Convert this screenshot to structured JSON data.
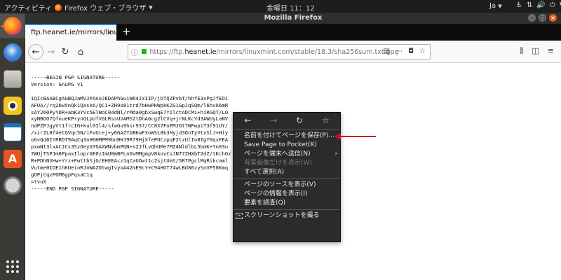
{
  "top_panel": {
    "activities": "アクティビティ",
    "app_name": "Firefox ウェブ・ブラウザ",
    "clock": "金曜日 11：12",
    "lang": "Ja"
  },
  "window": {
    "title": "Mozilla Firefox"
  },
  "tabs": [
    {
      "label": "ftp.heanet.ie/mirrors/linux"
    }
  ],
  "urlbar": {
    "url_pre": "https://ftp.",
    "url_host": "heanet.ie",
    "url_post": "/mirrors/linuxmint.com/stable/18.3/sha256sum.txt.gpg"
  },
  "pgp_text": "-----BEGIN PGP SIGNATURE-----\nVersion: GnuPG v1\n\niQIcBAABCgAGBQJaMVJPAAoJEDAPhGuiW64JzIIP/jbTQZPvbT/hhfE3xPgJfEOi\nAFUA//rq2Dw5nQk1Qask6/QC1+ZH9o81trd7bHwPKWpkKZG1GpJqSQm/l6hvk6mR\nsAY260PyYDR+abK3YVc5ElWoC04dNl/rMda0gbxSwqE7YIlctADCMi+hiRGQT/LO\nxyNBOO7QfnueKPrynGLpUfVGLRssUVAMS2tDhAGcg2lCVq+jrNLKcYd3AWUyLaNV\nndPZPJgyVt1frcIG+kul0Il4/sfwGu9hsr937/CC8X7FoFMJOt7WFwpiT3f91UY/\n/xirZL8f4etQVqc5N/iFvUcej+y6GAZYbBKwF3oWSL8k3Hyjd3QnTyVtxSlJ+Hiy\noGvQd8IYRRDT9AqCq3nH6HMPM9bnBHJ9R79HjXfePOCzpqF2tzUlIo8IgY0qxFEA\npxwNt3lxACJCs3SzOeyG7GAXWNvbmPQN+s2JfLvQhUMe7MZ4NldlbL5bmK+Yn03u\n7WUjTSPJm6PpaxIloprGE0zImU8mBFLn0vMMgmpV8kovCsJN77ZHXbT2dZ/tKchOz\nR+PDhNVHw+Yrz+FwttbSjG/EHEEAcz1qCaUOwt1c2sjtUmS/5R7PgclMqRikcaml\nVutme0IOE1hKUeinRJnWAZOtwgIvyoA42mE9cY+C94HOT74wLBd86zySnVP58Kmq\ngOPjCqzPOM6gpFqsaC1q\n=tvuX\n-----END PGP SIGNATURE-----",
  "context_menu": {
    "items": [
      {
        "label": "名前を付けてページを保存(P)...",
        "disabled": false,
        "submenu": false
      },
      {
        "label": "Save Page to Pocket(K)",
        "disabled": false,
        "submenu": false
      },
      {
        "label": "ページを端末へ送信(N)",
        "disabled": false,
        "submenu": true
      },
      {
        "label": "背景画像だけを表示(W)",
        "disabled": true,
        "submenu": false
      },
      {
        "label": "すべて選択(A)",
        "disabled": false,
        "submenu": false
      },
      {
        "label": "ページのソースを表示(V)",
        "disabled": false,
        "submenu": false
      },
      {
        "label": "ページの情報を表示(I)",
        "disabled": false,
        "submenu": false
      },
      {
        "label": "要素を調査(Q)",
        "disabled": false,
        "submenu": false
      },
      {
        "label": "スクリーンショットを撮る",
        "disabled": false,
        "submenu": false
      }
    ]
  },
  "colors": {
    "accent": "#0a84ff",
    "ubuntu_orange": "#e95420",
    "arrow_red": "#c8102e"
  }
}
